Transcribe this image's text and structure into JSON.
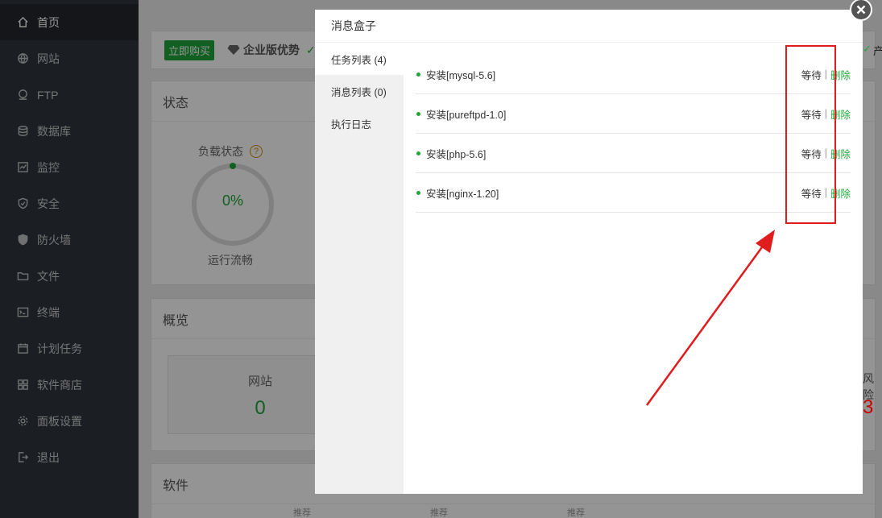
{
  "sidebar": {
    "items": [
      {
        "label": "首页",
        "icon": "home-icon",
        "active": true
      },
      {
        "label": "网站",
        "icon": "globe-icon"
      },
      {
        "label": "FTP",
        "icon": "ftp-icon"
      },
      {
        "label": "数据库",
        "icon": "database-icon"
      },
      {
        "label": "监控",
        "icon": "monitor-icon"
      },
      {
        "label": "安全",
        "icon": "shield-icon"
      },
      {
        "label": "防火墙",
        "icon": "firewall-icon"
      },
      {
        "label": "文件",
        "icon": "folder-icon"
      },
      {
        "label": "终端",
        "icon": "terminal-icon"
      },
      {
        "label": "计划任务",
        "icon": "calendar-icon"
      },
      {
        "label": "软件商店",
        "icon": "apps-icon"
      },
      {
        "label": "面板设置",
        "icon": "gear-icon"
      },
      {
        "label": "退出",
        "icon": "logout-icon"
      }
    ]
  },
  "dashboard": {
    "buy_label": "立即购买",
    "enterprise_label": "企业版优势",
    "status_title": "状态",
    "load_label": "负载状态",
    "load_value": "0%",
    "run_label": "运行流畅",
    "overview_title": "概览",
    "site_label": "网站",
    "site_count": "0",
    "software_title": "软件",
    "recommend_tag": "推荐",
    "risk_peek": "风险",
    "risk_value_peek": "3",
    "product_peek": "产"
  },
  "modal": {
    "title": "消息盒子",
    "tabs": [
      {
        "label": "任务列表 (4)",
        "active": true
      },
      {
        "label": "消息列表 (0)"
      },
      {
        "label": "执行日志"
      }
    ],
    "tasks": [
      {
        "name": "安装[mysql-5.6]",
        "status": "等待",
        "action": "删除"
      },
      {
        "name": "安装[pureftpd-1.0]",
        "status": "等待",
        "action": "删除"
      },
      {
        "name": "安装[php-5.6]",
        "status": "等待",
        "action": "删除"
      },
      {
        "name": "安装[nginx-1.20]",
        "status": "等待",
        "action": "删除"
      }
    ],
    "separator": "|"
  },
  "colors": {
    "accent": "#20a53a",
    "sidebar_bg": "#30353c",
    "annotation_red": "#e01c1c"
  }
}
